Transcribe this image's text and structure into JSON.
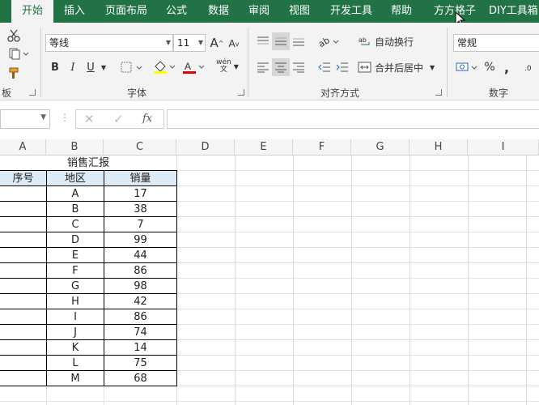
{
  "tabs": [
    "开始",
    "插入",
    "页面布局",
    "公式",
    "数据",
    "审阅",
    "视图",
    "开发工具",
    "帮助",
    "方方格子",
    "DIY工具箱"
  ],
  "ribbon": {
    "clipboard_label": "板",
    "font_group_label": "字体",
    "font_name": "等线",
    "font_size": "11",
    "bold": "B",
    "italic": "I",
    "underline": "U",
    "grow_font": "A",
    "shrink_font": "A",
    "phonetic": "wén",
    "align_group_label": "对齐方式",
    "wrap_text": "自动换行",
    "merge_center": "合并后居中",
    "number_group_label": "数字",
    "number_format": "常规",
    "percent": "%",
    "comma": ","
  },
  "formula_bar": {
    "name_box": "",
    "formula": "",
    "fx": "fx"
  },
  "columns": [
    "A",
    "B",
    "C",
    "D",
    "E",
    "F",
    "G",
    "H",
    "I"
  ],
  "sheet": {
    "title": "销售汇报",
    "headers": [
      "序号",
      "地区",
      "销量"
    ],
    "rows": [
      {
        "region": "A",
        "sales": "17"
      },
      {
        "region": "B",
        "sales": "38"
      },
      {
        "region": "C",
        "sales": "7"
      },
      {
        "region": "D",
        "sales": "99"
      },
      {
        "region": "E",
        "sales": "44"
      },
      {
        "region": "F",
        "sales": "86"
      },
      {
        "region": "G",
        "sales": "98"
      },
      {
        "region": "H",
        "sales": "42"
      },
      {
        "region": "I",
        "sales": "86"
      },
      {
        "region": "J",
        "sales": "74"
      },
      {
        "region": "K",
        "sales": "14"
      },
      {
        "region": "L",
        "sales": "75"
      },
      {
        "region": "M",
        "sales": "68"
      }
    ]
  },
  "colors": {
    "accent": "#217346",
    "header_fill": "#ddebf7",
    "font_color_bar": "#e00000",
    "highlight_bar": "#ffff00"
  }
}
